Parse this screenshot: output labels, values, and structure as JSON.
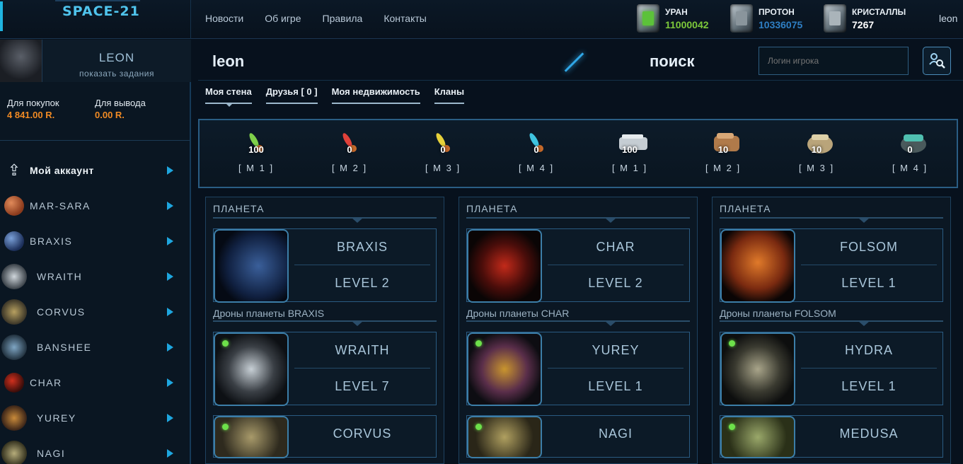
{
  "app": {
    "logo": "SPACE-21"
  },
  "nav": [
    "Новости",
    "Об игре",
    "Правила",
    "Контакты"
  ],
  "resources": [
    {
      "label": "УРАН",
      "value": "11000042",
      "color": "#7cc83a",
      "icon": "uranium-cube-icon"
    },
    {
      "label": "ПРОТОН",
      "value": "10336075",
      "color": "#2e7fc4",
      "icon": "proton-cube-icon"
    },
    {
      "label": "КРИСТАЛЛЫ",
      "value": "7267",
      "color": "#ffffff",
      "icon": "crystal-cube-icon"
    }
  ],
  "user": {
    "login": "leon",
    "display_name": "LEON",
    "tasks_link": "показать задания"
  },
  "balance": {
    "buy_label": "Для покупок",
    "buy_value": "4 841.00 R.",
    "withdraw_label": "Для вывода",
    "withdraw_value": "0.00 R."
  },
  "menu": [
    {
      "label": "Мой аккаунт",
      "icon": "account-upload-icon"
    },
    {
      "label": "MAR-SARA",
      "icon": "planet-marsara-icon"
    },
    {
      "label": "BRAXIS",
      "icon": "planet-braxis-icon"
    },
    {
      "label": "WRAITH",
      "icon": "drone-wraith-icon"
    },
    {
      "label": "CORVUS",
      "icon": "drone-corvus-icon"
    },
    {
      "label": "BANSHEE",
      "icon": "drone-banshee-icon"
    },
    {
      "label": "CHAR",
      "icon": "planet-char-icon"
    },
    {
      "label": "YUREY",
      "icon": "drone-yurey-icon"
    },
    {
      "label": "NAGI",
      "icon": "drone-nagi-icon"
    }
  ],
  "profile": {
    "name": "leon",
    "search_label": "поиск",
    "search_placeholder": "Логин игрока"
  },
  "tabs": [
    "Моя стена",
    "Друзья [ 0 ]",
    "Моя недвижимость",
    "Кланы"
  ],
  "inventory": [
    {
      "qty": "100",
      "code": "[ M 1 ]",
      "color": "#7fd04a",
      "kind": "missile"
    },
    {
      "qty": "0",
      "code": "[ M 2 ]",
      "color": "#e0413a",
      "kind": "missile"
    },
    {
      "qty": "0",
      "code": "[ M 3 ]",
      "color": "#e7d13a",
      "kind": "missile"
    },
    {
      "qty": "0",
      "code": "[ M 4 ]",
      "color": "#3fc4e0",
      "kind": "missile"
    },
    {
      "qty": "100",
      "code": "[ M 1 ]",
      "color": "#c5cdd3",
      "kind": "module"
    },
    {
      "qty": "10",
      "code": "[ M 2 ]",
      "color": "#b07a4a",
      "kind": "module"
    },
    {
      "qty": "10",
      "code": "[ M 3 ]",
      "color": "#b9a47a",
      "kind": "module"
    },
    {
      "qty": "0",
      "code": "[ M 4 ]",
      "color": "#4fbfb0",
      "kind": "module"
    }
  ],
  "columns": [
    {
      "header": "ПЛАНЕТА",
      "planet": "BRAXIS",
      "planet_level": "LEVEL 2",
      "planet_color": "#2b4f86",
      "drones_label": "Дроны планеты BRAXIS",
      "drone1": "WRAITH",
      "drone1_level": "LEVEL 7",
      "drone2": "CORVUS"
    },
    {
      "header": "ПЛАНЕТА",
      "planet": "CHAR",
      "planet_level": "LEVEL 2",
      "planet_color": "#b02a1c",
      "drones_label": "Дроны планеты CHAR",
      "drone1": "YUREY",
      "drone1_level": "LEVEL 1",
      "drone2": "NAGI"
    },
    {
      "header": "ПЛАНЕТА",
      "planet": "FOLSOM",
      "planet_level": "LEVEL 1",
      "planet_color": "#c8561e",
      "drones_label": "Дроны планеты FOLSOM",
      "drone1": "HYDRA",
      "drone1_level": "LEVEL 1",
      "drone2": "MEDUSA"
    }
  ]
}
